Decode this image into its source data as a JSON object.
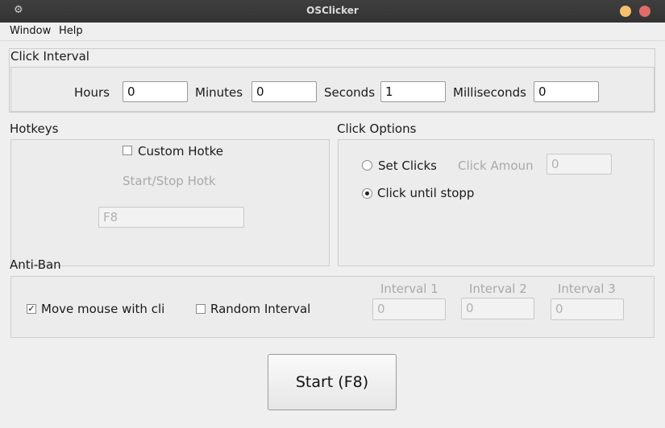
{
  "window": {
    "title": "OSClicker",
    "icon": "gear-icon"
  },
  "menu": [
    "Window",
    "Help"
  ],
  "click_interval": {
    "title": "Click Interval",
    "hours_label": "Hours",
    "hours_value": "0",
    "minutes_label": "Minutes",
    "minutes_value": "0",
    "seconds_label": "Seconds",
    "seconds_value": "1",
    "milliseconds_label": "Milliseconds",
    "milliseconds_value": "0"
  },
  "hotkeys": {
    "title": "Hotkeys",
    "custom_label": "Custom Hotke",
    "custom_checked": false,
    "start_stop_label": "Start/Stop Hotk",
    "hotkey_value": "F8"
  },
  "click_options": {
    "title": "Click Options",
    "set_clicks_label": "Set Clicks",
    "click_amount_label": "Click Amoun",
    "click_amount_value": "0",
    "until_stopped_label": "Click until stopp",
    "selected": "until_stopped"
  },
  "anti_ban": {
    "title": "Anti-Ban",
    "move_mouse_label": "Move mouse with cli",
    "move_mouse_checked": true,
    "random_interval_label": "Random Interval",
    "random_interval_checked": false,
    "interval1_label": "Interval 1",
    "interval1_value": "0",
    "interval2_label": "Interval 2",
    "interval2_value": "0",
    "interval3_label": "Interval 3",
    "interval3_value": "0"
  },
  "start_button": "Start (F8)",
  "colors": {
    "titlebar": "#373737",
    "minimize": "#f3c06d",
    "close": "#e06c6c",
    "window_bg": "#efefef"
  }
}
